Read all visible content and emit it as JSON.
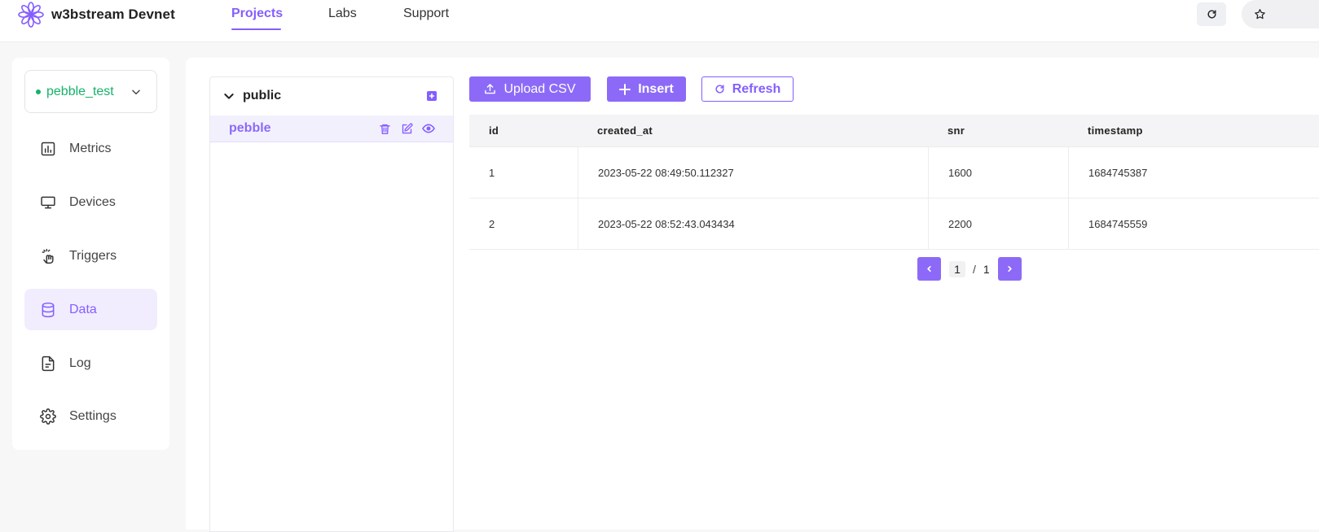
{
  "header": {
    "brand": "w3bstream Devnet",
    "nav": [
      "Projects",
      "Labs",
      "Support"
    ],
    "active_nav": "Projects",
    "icons": {
      "logo": "flower-logo-icon",
      "refresh": "refresh-icon",
      "star": "star-icon"
    }
  },
  "sidebar": {
    "project_name": "pebble_test",
    "project_status_color": "#16b26a",
    "items": [
      {
        "label": "Metrics",
        "icon": "bar-chart-icon"
      },
      {
        "label": "Devices",
        "icon": "monitor-icon"
      },
      {
        "label": "Triggers",
        "icon": "pointer-click-icon"
      },
      {
        "label": "Data",
        "icon": "database-icon"
      },
      {
        "label": "Log",
        "icon": "file-text-icon"
      },
      {
        "label": "Settings",
        "icon": "gear-icon"
      }
    ],
    "active_item": "Data"
  },
  "tree": {
    "schema": "public",
    "tables": [
      {
        "name": "pebble"
      }
    ]
  },
  "toolbar": {
    "upload_label": "Upload CSV",
    "insert_label": "Insert",
    "refresh_label": "Refresh"
  },
  "table": {
    "columns": [
      "id",
      "created_at",
      "snr",
      "timestamp"
    ],
    "rows": [
      [
        "1",
        "2023-05-22 08:49:50.112327",
        "1600",
        "1684745387"
      ],
      [
        "2",
        "2023-05-22 08:52:43.043434",
        "2200",
        "1684745559"
      ]
    ]
  },
  "pagination": {
    "current": "1",
    "separator": "/",
    "total": "1"
  },
  "colors": {
    "accent": "#855eff",
    "accent_light": "#f1edff",
    "success": "#16b26a"
  }
}
